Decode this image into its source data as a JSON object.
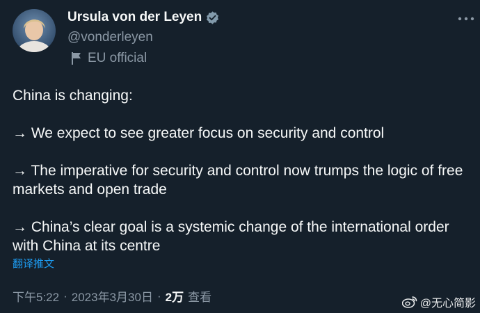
{
  "author": {
    "display_name": "Ursula von der Leyen",
    "handle": "@vonderleyen",
    "affiliation": "EU official"
  },
  "icons": [
    "verified-badge-icon",
    "flag-icon",
    "more-icon",
    "weibo-icon"
  ],
  "tweet": {
    "paragraphs": [
      "China is changing:",
      "→ We expect to see greater focus on security and control",
      "→ The imperative for security and control now trumps the logic of free markets and open trade",
      "→ China’s clear goal is a systemic change of the international order with China at its centre"
    ],
    "translate_label": "翻译推文"
  },
  "meta": {
    "time": "下午5:22",
    "date": "2023年3月30日",
    "separator": "·",
    "views_count": "2万",
    "views_label": "查看"
  },
  "watermark": "@无心简影"
}
